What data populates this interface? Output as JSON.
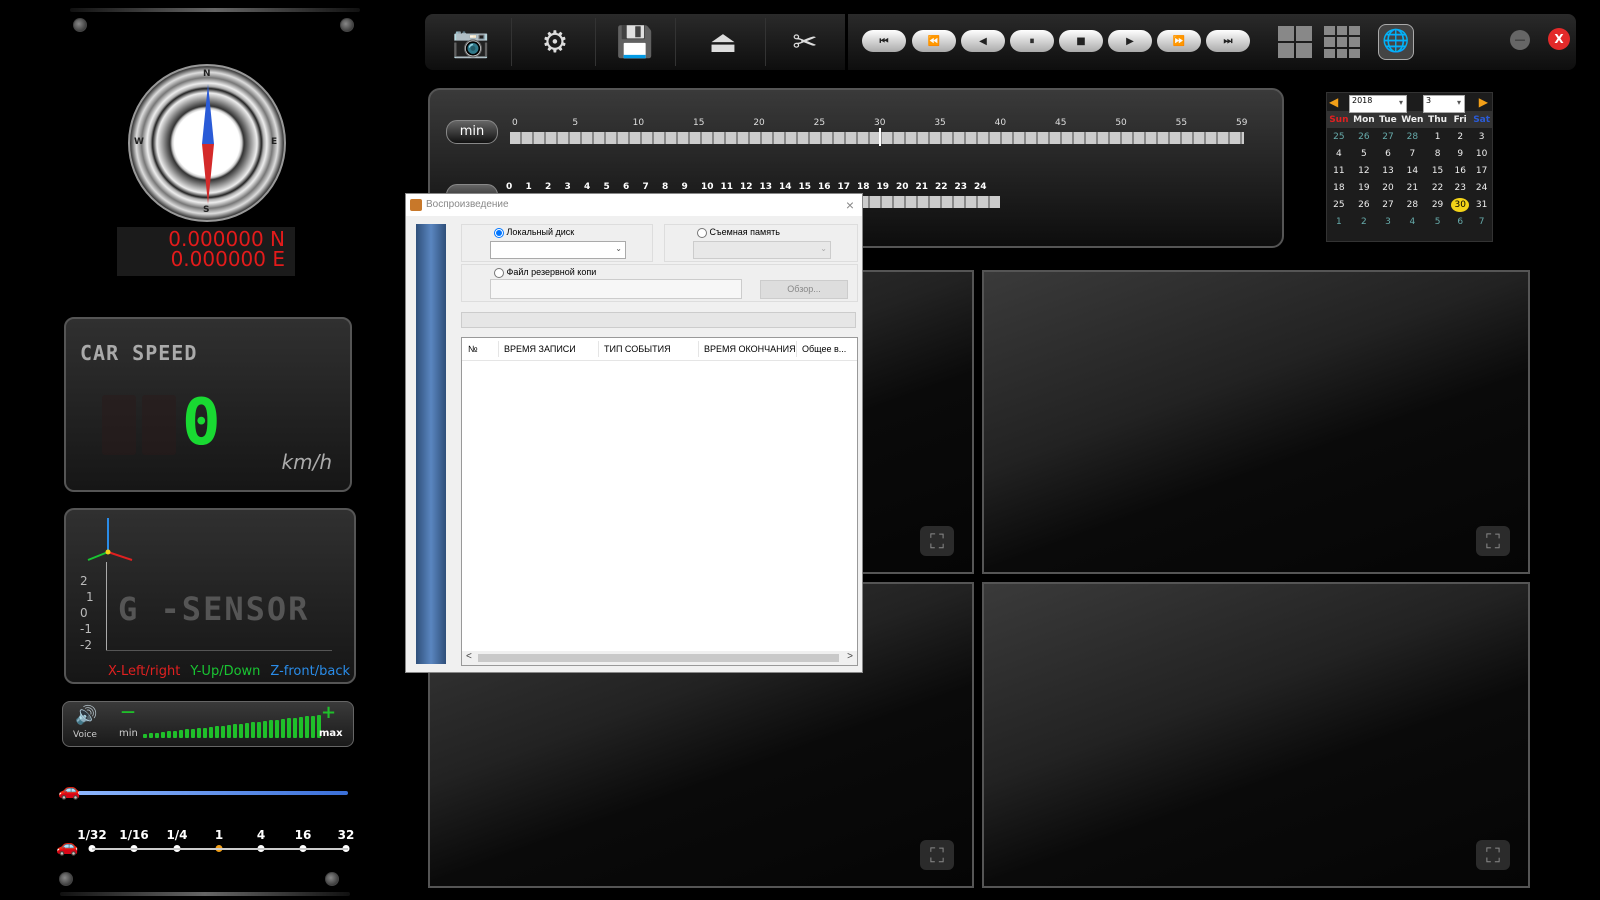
{
  "coords": {
    "lat": "0.000000 N",
    "lon": "0.000000 E"
  },
  "compass_letters": {
    "n": "N",
    "s": "S",
    "e": "E",
    "w": "W"
  },
  "speed": {
    "title": "CAR SPEED",
    "value": "0",
    "unit": "km/h"
  },
  "gsensor": {
    "title": "G -SENSOR",
    "scale": [
      "2",
      "1",
      "0",
      "-1",
      "-2"
    ],
    "legend_x": "X-Left/right",
    "legend_y": "Y-Up/Down",
    "legend_z": "Z-front/back"
  },
  "voice": {
    "label": "Voice",
    "min": "min",
    "max": "max",
    "minus": "—",
    "plus": "+"
  },
  "progress": {
    "position": 0.0
  },
  "playback_speeds": [
    "1/32",
    "1/16",
    "1/4",
    "1",
    "4",
    "16",
    "32"
  ],
  "playback_speed_selected_index": 3,
  "toolbar": {
    "icons": [
      "camera-icon",
      "settings-icon",
      "save-icon",
      "eject-icon",
      "tools-icon"
    ]
  },
  "playback_buttons": [
    "⏮",
    "⏪",
    "◀",
    "⏸",
    "■",
    "▶",
    "⏩",
    "⏭"
  ],
  "timeline": {
    "min_label": "min",
    "minute_ticks": [
      "0",
      "5",
      "10",
      "15",
      "20",
      "25",
      "30",
      "35",
      "40",
      "45",
      "50",
      "55",
      "59"
    ],
    "hour_ticks": [
      "0",
      "1",
      "2",
      "3",
      "4",
      "5",
      "6",
      "7",
      "8",
      "9",
      "10",
      "11",
      "12",
      "13",
      "14",
      "15",
      "16",
      "17",
      "18",
      "19",
      "20",
      "21",
      "22",
      "23",
      "24"
    ]
  },
  "calendar": {
    "year": "2018",
    "month": "3",
    "weekdays": [
      "Sun",
      "Mon",
      "Tue",
      "Wen",
      "Thu",
      "Fri",
      "Sat"
    ],
    "weeks": [
      [
        "25",
        "26",
        "27",
        "28",
        "1",
        "2",
        "3"
      ],
      [
        "4",
        "5",
        "6",
        "7",
        "8",
        "9",
        "10"
      ],
      [
        "11",
        "12",
        "13",
        "14",
        "15",
        "16",
        "17"
      ],
      [
        "18",
        "19",
        "20",
        "21",
        "22",
        "23",
        "24"
      ],
      [
        "25",
        "26",
        "27",
        "28",
        "29",
        "30",
        "31"
      ],
      [
        "1",
        "2",
        "3",
        "4",
        "5",
        "6",
        "7"
      ]
    ],
    "selected": "30"
  },
  "dialog": {
    "title": "Воспроизведение",
    "close": "×",
    "local_disk": "Локальный диск",
    "removable": "Съемная память",
    "backup_file": "Файл резервной копи",
    "browse": "Обзор...",
    "columns": [
      "№",
      "ВРЕМЯ ЗАПИСИ",
      "ТИП СОБЫТИЯ",
      "ВРЕМЯ ОКОНЧАНИЯ",
      "Общее в..."
    ],
    "scroll_left": "<",
    "scroll_right": ">"
  },
  "window_controls": {
    "minimize": "—",
    "close": "X"
  },
  "colors": {
    "speed_digit": "#19d932",
    "coords": "#e31b1b",
    "calendar_selected": "#f3d318",
    "legend_x": "#e02020",
    "legend_y": "#19c532",
    "legend_z": "#2a8ce8"
  }
}
